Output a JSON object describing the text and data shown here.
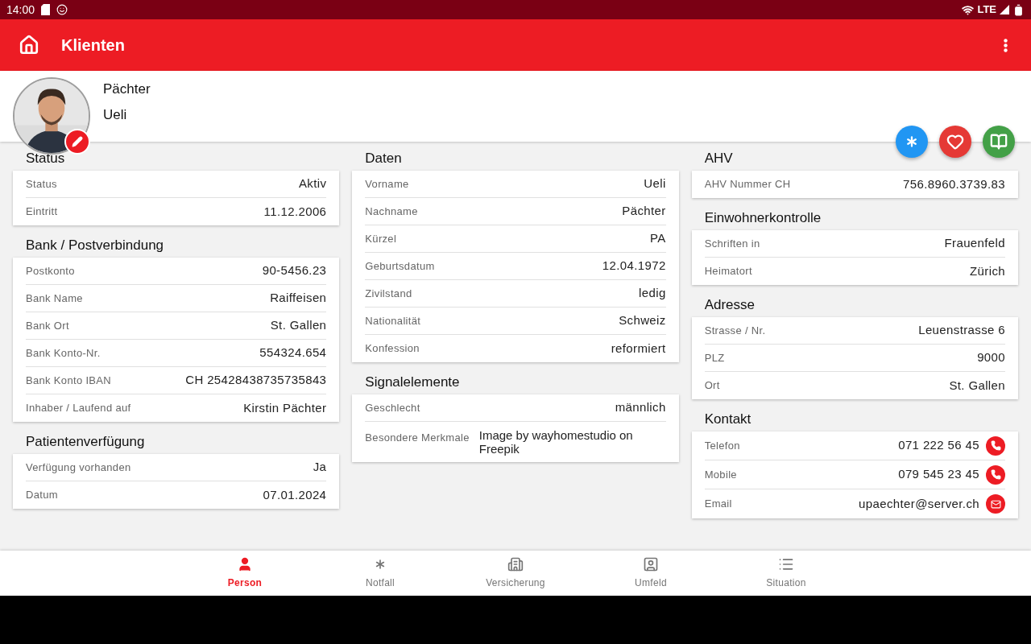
{
  "status_bar": {
    "time": "14:00",
    "network": "LTE"
  },
  "app_bar": {
    "title": "Klienten"
  },
  "client": {
    "last_name": "Pächter",
    "first_name": "Ueli"
  },
  "actions": [
    {
      "kind": "asterisk",
      "color": "#2196f3"
    },
    {
      "kind": "heart",
      "color": "#e53935"
    },
    {
      "kind": "book",
      "color": "#43a047"
    }
  ],
  "columns": [
    [
      {
        "title": "Status",
        "rows": [
          {
            "kind": "field",
            "label": "Status",
            "value": "Aktiv"
          },
          {
            "kind": "field",
            "label": "Eintritt",
            "value": "11.12.2006"
          }
        ]
      },
      {
        "title": "Bank / Postverbindung",
        "rows": [
          {
            "kind": "field",
            "label": "Postkonto",
            "value": "90-5456.23"
          },
          {
            "kind": "field",
            "label": "Bank Name",
            "value": "Raiffeisen"
          },
          {
            "kind": "field",
            "label": "Bank Ort",
            "value": "St. Gallen"
          },
          {
            "kind": "field",
            "label": "Bank Konto-Nr.",
            "value": "554324.654"
          },
          {
            "kind": "field",
            "label": "Bank Konto IBAN",
            "value": "CH 25428438735735843"
          },
          {
            "kind": "field",
            "label": "Inhaber / Laufend auf",
            "value": "Kirstin Pächter"
          }
        ]
      },
      {
        "title": "Patientenverfügung",
        "rows": [
          {
            "kind": "field",
            "label": "Verfügung vorhanden",
            "value": "Ja"
          },
          {
            "kind": "field",
            "label": "Datum",
            "value": "07.01.2024"
          }
        ]
      }
    ],
    [
      {
        "title": "Daten",
        "rows": [
          {
            "kind": "field",
            "label": "Vorname",
            "value": "Ueli"
          },
          {
            "kind": "field",
            "label": "Nachname",
            "value": "Pächter"
          },
          {
            "kind": "field",
            "label": "Kürzel",
            "value": "PA"
          },
          {
            "kind": "field",
            "label": "Geburtsdatum",
            "value": "12.04.1972"
          },
          {
            "kind": "field",
            "label": "Zivilstand",
            "value": "ledig"
          },
          {
            "kind": "field",
            "label": "Nationalität",
            "value": "Schweiz"
          },
          {
            "kind": "field",
            "label": "Konfession",
            "value": "reformiert"
          }
        ]
      },
      {
        "title": "Signalelemente",
        "rows": [
          {
            "kind": "field",
            "label": "Geschlecht",
            "value": "männlich"
          },
          {
            "kind": "note",
            "label": "Besondere Merkmale",
            "value": "Image by wayhomestudio on Freepik"
          }
        ]
      }
    ],
    [
      {
        "title": "AHV",
        "rows": [
          {
            "kind": "field",
            "label": "AHV Nummer CH",
            "value": "756.8960.3739.83"
          }
        ]
      },
      {
        "title": "Einwohnerkontrolle",
        "rows": [
          {
            "kind": "field",
            "label": "Schriften in",
            "value": "Frauenfeld"
          },
          {
            "kind": "field",
            "label": "Heimatort",
            "value": "Zürich"
          }
        ]
      },
      {
        "title": "Adresse",
        "rows": [
          {
            "kind": "field",
            "label": "Strasse / Nr.",
            "value": "Leuenstrasse 6"
          },
          {
            "kind": "field",
            "label": "PLZ",
            "value": "9000"
          },
          {
            "kind": "field",
            "label": "Ort",
            "value": "St. Gallen"
          }
        ]
      },
      {
        "title": "Kontakt",
        "rows": [
          {
            "kind": "phone",
            "label": "Telefon",
            "value": "071 222 56 45"
          },
          {
            "kind": "phone",
            "label": "Mobile",
            "value": "079 545 23 45"
          },
          {
            "kind": "email",
            "label": "Email",
            "value": "upaechter@server.ch"
          }
        ]
      }
    ]
  ],
  "tabs": [
    {
      "kind": "person",
      "label": "Person",
      "selected": true
    },
    {
      "kind": "asterisk",
      "label": "Notfall",
      "selected": false
    },
    {
      "kind": "building",
      "label": "Versicherung",
      "selected": false
    },
    {
      "kind": "portrait",
      "label": "Umfeld",
      "selected": false
    },
    {
      "kind": "list",
      "label": "Situation",
      "selected": false
    }
  ]
}
